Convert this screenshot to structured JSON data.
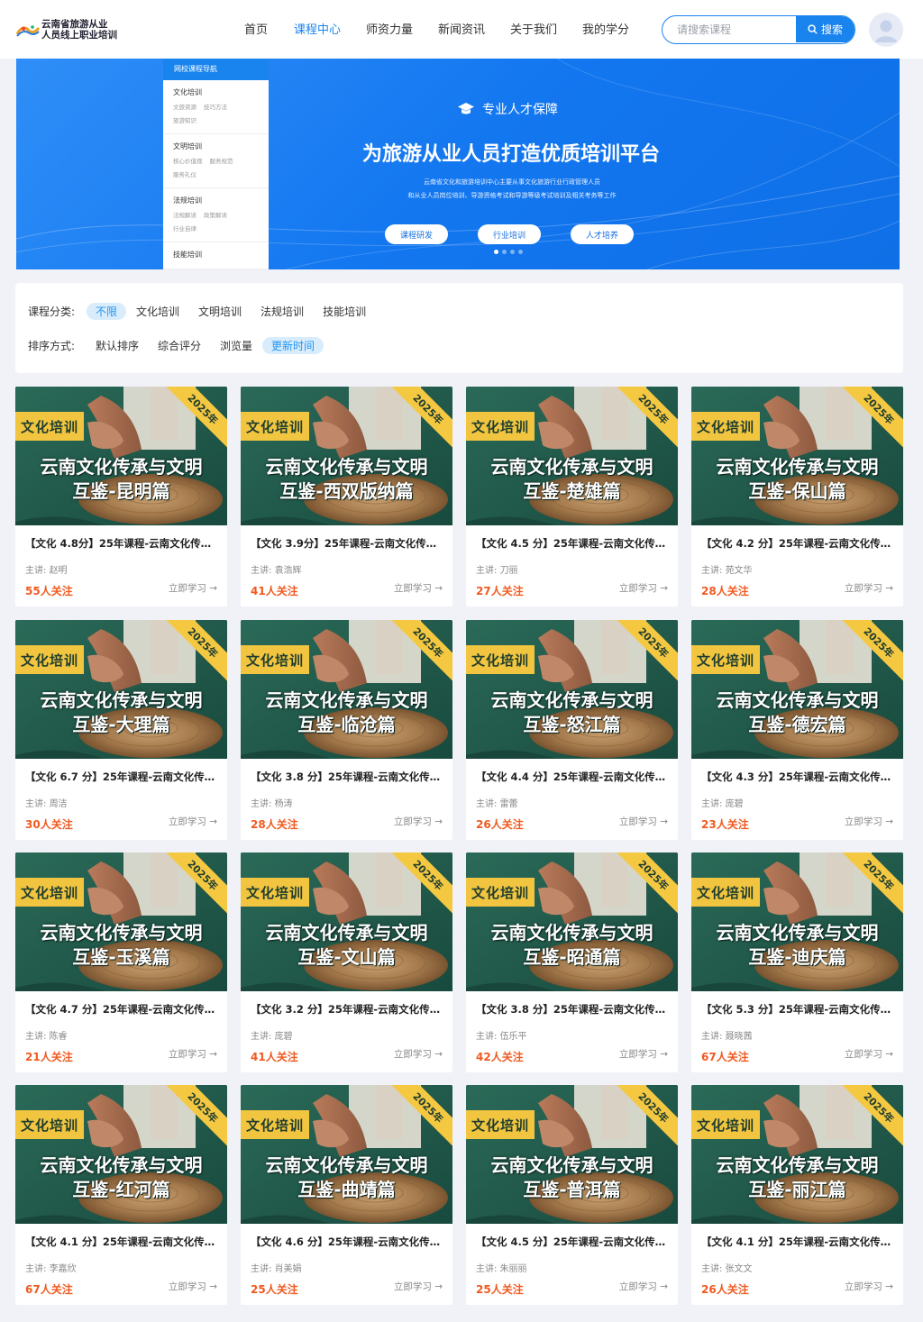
{
  "header": {
    "logo_line1": "云南省旅游从业",
    "logo_line2": "人员线上职业培训",
    "nav": [
      "首页",
      "课程中心",
      "师资力量",
      "新闻资讯",
      "关于我们",
      "我的学分"
    ],
    "active_nav": 1,
    "search_placeholder": "请搜索课程",
    "search_button": "搜索"
  },
  "banner": {
    "side_nav_title": "网校课程导航",
    "side_groups": [
      {
        "title": "文化培训",
        "subs": [
          "文旅资源",
          "技巧方法",
          "旅游知识"
        ]
      },
      {
        "title": "文明培训",
        "subs": [
          "核心价值观",
          "服务规范",
          "服务礼仪"
        ]
      },
      {
        "title": "法规培训",
        "subs": [
          "法规解读",
          "政策解读",
          "行业自律"
        ]
      },
      {
        "title": "技能培训",
        "subs": []
      }
    ],
    "badge": "专业人才保障",
    "title": "为旅游从业人员打造优质培训平台",
    "desc_line1": "云南省文化和旅游培训中心主要从事文化旅游行业行政管理人员",
    "desc_line2": "和从业人员岗位培训、导游资格考试和导游等级考试培训及相关考务等工作",
    "buttons": [
      "课程研发",
      "行业培训",
      "人才培养"
    ]
  },
  "filter": {
    "category_label": "课程分类:",
    "categories": [
      "不限",
      "文化培训",
      "文明培训",
      "法规培训",
      "技能培训"
    ],
    "category_active": 0,
    "sort_label": "排序方式:",
    "sorts": [
      "默认排序",
      "综合评分",
      "浏览量",
      "更新时间"
    ],
    "sort_active": 3
  },
  "card_common": {
    "tag": "文化培训",
    "year": "2025年",
    "thumb_line1": "云南文化传承与文明",
    "lecturer_prefix": "主讲: ",
    "follow_suffix": "人关注",
    "study": "立即学习 →"
  },
  "courses": [
    {
      "city": "互鉴-昆明篇",
      "title": "【文化 4.8分】25年课程-云南文化传承与文明互鉴-昆明篇",
      "lecturer": "赵明",
      "followers": "55"
    },
    {
      "city": "互鉴-西双版纳篇",
      "title": "【文化 3.9分】25年课程-云南文化传承与文明互鉴-西双版纳篇",
      "lecturer": "袁浩辉",
      "followers": "41"
    },
    {
      "city": "互鉴-楚雄篇",
      "title": "【文化 4.5 分】25年课程-云南文化传承与文明互鉴-楚雄篇",
      "lecturer": "刀丽",
      "followers": "27"
    },
    {
      "city": "互鉴-保山篇",
      "title": "【文化 4.2 分】25年课程-云南文化传承与文明互鉴-保山篇",
      "lecturer": "苑文华",
      "followers": "28"
    },
    {
      "city": "互鉴-大理篇",
      "title": "【文化 6.7 分】25年课程-云南文化传承与文明互鉴-大理篇",
      "lecturer": "周洁",
      "followers": "30"
    },
    {
      "city": "互鉴-临沧篇",
      "title": "【文化 3.8 分】25年课程-云南文化传承与文明互鉴-临沧篇",
      "lecturer": "杨涛",
      "followers": "28"
    },
    {
      "city": "互鉴-怒江篇",
      "title": "【文化 4.4 分】25年课程-云南文化传承与文明互鉴-怒江篇",
      "lecturer": "雷蕾",
      "followers": "26"
    },
    {
      "city": "互鉴-德宏篇",
      "title": "【文化 4.3 分】25年课程-云南文化传承与文明互鉴-德宏篇",
      "lecturer": "庞碧",
      "followers": "23"
    },
    {
      "city": "互鉴-玉溪篇",
      "title": "【文化 4.7 分】25年课程-云南文化传承与文明互鉴-玉溪篇",
      "lecturer": "陈睿",
      "followers": "21"
    },
    {
      "city": "互鉴-文山篇",
      "title": "【文化 3.2 分】25年课程-云南文化传承与文明互鉴-文山篇",
      "lecturer": "庞碧",
      "followers": "41"
    },
    {
      "city": "互鉴-昭通篇",
      "title": "【文化 3.8 分】25年课程-云南文化传承与文明互鉴-昭通篇",
      "lecturer": "伍乐平",
      "followers": "42"
    },
    {
      "city": "互鉴-迪庆篇",
      "title": "【文化 5.3 分】25年课程-云南文化传承与文明互鉴-迪庆篇",
      "lecturer": "聂晓茜",
      "followers": "67"
    },
    {
      "city": "互鉴-红河篇",
      "title": "【文化 4.1 分】25年课程-云南文化传承与文明互鉴-红河篇",
      "lecturer": "李嘉欣",
      "followers": "67"
    },
    {
      "city": "互鉴-曲靖篇",
      "title": "【文化 4.6 分】25年课程-云南文化传承与文明互鉴-曲靖篇",
      "lecturer": "肖美娟",
      "followers": "25"
    },
    {
      "city": "互鉴-普洱篇",
      "title": "【文化 4.5 分】25年课程-云南文化传承与文明互鉴-普洱篇",
      "lecturer": "朱丽丽",
      "followers": "25"
    },
    {
      "city": "互鉴-丽江篇",
      "title": "【文化 4.1 分】25年课程-云南文化传承与文明互鉴-丽江篇",
      "lecturer": "张文文",
      "followers": "26"
    }
  ],
  "colors": {
    "accent": "#1a84ee",
    "follow": "#f05a20",
    "thumb_bg": "#1f5b4c",
    "tag": "#f1c53f"
  }
}
